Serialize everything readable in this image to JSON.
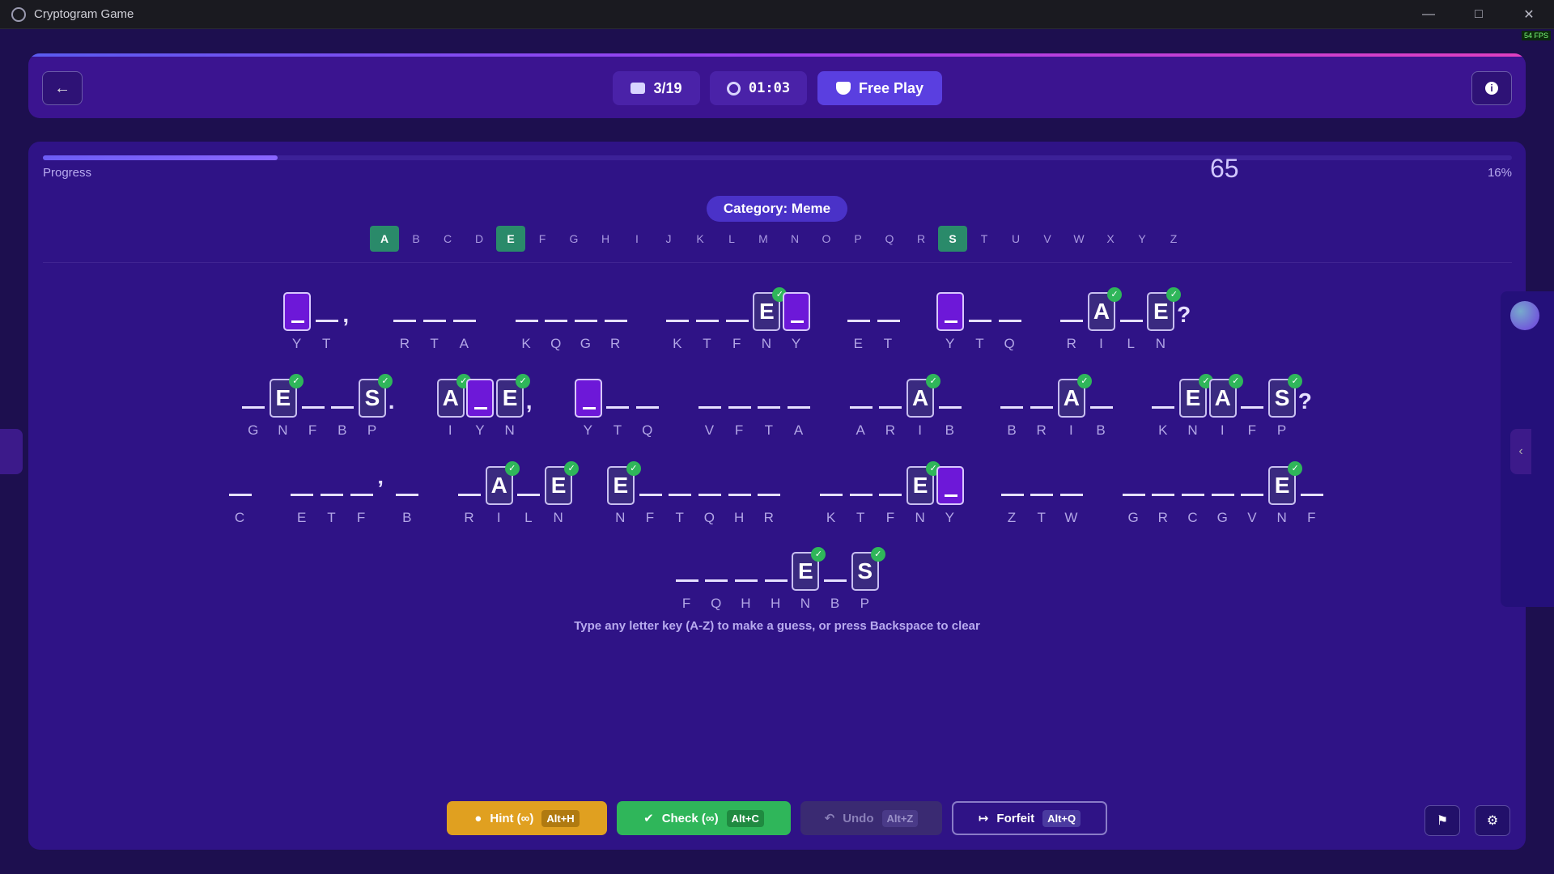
{
  "window": {
    "title": "Cryptogram Game",
    "fps": "54 FPS"
  },
  "header": {
    "puzzle": "3/19",
    "timer": "01:03",
    "mode": "Free Play"
  },
  "progress": {
    "label": "Progress",
    "percent_text": "16%",
    "fraction": 0.16
  },
  "category": "Category: Meme",
  "alphabet": [
    {
      "l": "A",
      "used": true
    },
    {
      "l": "B",
      "used": false
    },
    {
      "l": "C",
      "used": false
    },
    {
      "l": "D",
      "used": false
    },
    {
      "l": "E",
      "used": true
    },
    {
      "l": "F",
      "used": false
    },
    {
      "l": "G",
      "used": false
    },
    {
      "l": "H",
      "used": false
    },
    {
      "l": "I",
      "used": false
    },
    {
      "l": "J",
      "used": false
    },
    {
      "l": "K",
      "used": false
    },
    {
      "l": "L",
      "used": false
    },
    {
      "l": "M",
      "used": false
    },
    {
      "l": "N",
      "used": false
    },
    {
      "l": "O",
      "used": false
    },
    {
      "l": "P",
      "used": false
    },
    {
      "l": "Q",
      "used": false
    },
    {
      "l": "R",
      "used": false
    },
    {
      "l": "S",
      "used": true
    },
    {
      "l": "T",
      "used": false
    },
    {
      "l": "U",
      "used": false
    },
    {
      "l": "V",
      "used": false
    },
    {
      "l": "W",
      "used": false
    },
    {
      "l": "X",
      "used": false
    },
    {
      "l": "Y",
      "used": false
    },
    {
      "l": "Z",
      "used": false
    }
  ],
  "score": "65",
  "rows": [
    [
      {
        "c": "Y",
        "a": "",
        "s": "empty"
      },
      {
        "c": "T",
        "a": "",
        "s": "slot"
      },
      {
        "p": ","
      },
      {
        "gap": 1
      },
      {
        "c": "R",
        "a": "",
        "s": "slot"
      },
      {
        "c": "T",
        "a": "",
        "s": "slot"
      },
      {
        "c": "A",
        "a": "",
        "s": "slot"
      },
      {
        "gap": 1
      },
      {
        "c": "K",
        "a": "",
        "s": "slot"
      },
      {
        "c": "Q",
        "a": "",
        "s": "slot"
      },
      {
        "c": "G",
        "a": "",
        "s": "slot"
      },
      {
        "c": "R",
        "a": "",
        "s": "slot"
      },
      {
        "gap": 1
      },
      {
        "c": "K",
        "a": "",
        "s": "slot"
      },
      {
        "c": "T",
        "a": "",
        "s": "slot"
      },
      {
        "c": "F",
        "a": "",
        "s": "slot"
      },
      {
        "c": "N",
        "a": "E",
        "s": "filled"
      },
      {
        "c": "Y",
        "a": "",
        "s": "empty"
      },
      {
        "gap": 1
      },
      {
        "c": "E",
        "a": "",
        "s": "slot"
      },
      {
        "c": "T",
        "a": "",
        "s": "slot"
      },
      {
        "gap": 1
      },
      {
        "c": "Y",
        "a": "",
        "s": "empty"
      },
      {
        "c": "T",
        "a": "",
        "s": "slot"
      },
      {
        "c": "Q",
        "a": "",
        "s": "slot"
      },
      {
        "gap": 1
      },
      {
        "c": "R",
        "a": "",
        "s": "slot"
      },
      {
        "c": "I",
        "a": "A",
        "s": "filled"
      },
      {
        "c": "L",
        "a": "",
        "s": "slot"
      },
      {
        "c": "N",
        "a": "E",
        "s": "filled"
      },
      {
        "p": "?"
      }
    ],
    [
      {
        "c": "G",
        "a": "",
        "s": "slot"
      },
      {
        "c": "N",
        "a": "E",
        "s": "filled"
      },
      {
        "c": "F",
        "a": "",
        "s": "slot"
      },
      {
        "c": "B",
        "a": "",
        "s": "slot"
      },
      {
        "c": "P",
        "a": "S",
        "s": "filled"
      },
      {
        "p": "."
      },
      {
        "gap": 1
      },
      {
        "c": "I",
        "a": "A",
        "s": "filled"
      },
      {
        "c": "Y",
        "a": "",
        "s": "empty"
      },
      {
        "c": "N",
        "a": "E",
        "s": "filled"
      },
      {
        "p": ","
      },
      {
        "gap": 1
      },
      {
        "c": "Y",
        "a": "",
        "s": "empty"
      },
      {
        "c": "T",
        "a": "",
        "s": "slot"
      },
      {
        "c": "Q",
        "a": "",
        "s": "slot"
      },
      {
        "gap": 1
      },
      {
        "c": "V",
        "a": "",
        "s": "slot"
      },
      {
        "c": "F",
        "a": "",
        "s": "slot"
      },
      {
        "c": "T",
        "a": "",
        "s": "slot"
      },
      {
        "c": "A",
        "a": "",
        "s": "slot"
      },
      {
        "gap": 1
      },
      {
        "c": "A",
        "a": "",
        "s": "slot"
      },
      {
        "c": "R",
        "a": "",
        "s": "slot"
      },
      {
        "c": "I",
        "a": "A",
        "s": "filled"
      },
      {
        "c": "B",
        "a": "",
        "s": "slot"
      },
      {
        "gap": 1
      },
      {
        "c": "B",
        "a": "",
        "s": "slot"
      },
      {
        "c": "R",
        "a": "",
        "s": "slot"
      },
      {
        "c": "I",
        "a": "A",
        "s": "filled"
      },
      {
        "c": "B",
        "a": "",
        "s": "slot"
      },
      {
        "gap": 1
      },
      {
        "c": "K",
        "a": "",
        "s": "slot"
      },
      {
        "c": "N",
        "a": "E",
        "s": "filled"
      },
      {
        "c": "I",
        "a": "A",
        "s": "filled"
      },
      {
        "c": "F",
        "a": "",
        "s": "slot"
      },
      {
        "c": "P",
        "a": "S",
        "s": "filled"
      },
      {
        "p": "?"
      }
    ],
    [
      {
        "c": "C",
        "a": "",
        "s": "slot"
      },
      {
        "gap": 1
      },
      {
        "c": "E",
        "a": "",
        "s": "slot"
      },
      {
        "c": "T",
        "a": "",
        "s": "slot"
      },
      {
        "c": "F",
        "a": "",
        "s": "slot"
      },
      {
        "p": "’"
      },
      {
        "c": "B",
        "a": "",
        "s": "slot"
      },
      {
        "gap": 1
      },
      {
        "c": "R",
        "a": "",
        "s": "slot"
      },
      {
        "c": "I",
        "a": "A",
        "s": "filled"
      },
      {
        "c": "L",
        "a": "",
        "s": "slot"
      },
      {
        "c": "N",
        "a": "E",
        "s": "filled"
      },
      {
        "gap": 1
      },
      {
        "c": "N",
        "a": "E",
        "s": "filled"
      },
      {
        "c": "F",
        "a": "",
        "s": "slot"
      },
      {
        "c": "T",
        "a": "",
        "s": "slot"
      },
      {
        "c": "Q",
        "a": "",
        "s": "slot"
      },
      {
        "c": "H",
        "a": "",
        "s": "slot"
      },
      {
        "c": "R",
        "a": "",
        "s": "slot"
      },
      {
        "gap": 1
      },
      {
        "c": "K",
        "a": "",
        "s": "slot"
      },
      {
        "c": "T",
        "a": "",
        "s": "slot"
      },
      {
        "c": "F",
        "a": "",
        "s": "slot"
      },
      {
        "c": "N",
        "a": "E",
        "s": "filled"
      },
      {
        "c": "Y",
        "a": "",
        "s": "empty"
      },
      {
        "gap": 1
      },
      {
        "c": "Z",
        "a": "",
        "s": "slot"
      },
      {
        "c": "T",
        "a": "",
        "s": "slot"
      },
      {
        "c": "W",
        "a": "",
        "s": "slot"
      },
      {
        "gap": 1
      },
      {
        "c": "G",
        "a": "",
        "s": "slot"
      },
      {
        "c": "R",
        "a": "",
        "s": "slot"
      },
      {
        "c": "C",
        "a": "",
        "s": "slot"
      },
      {
        "c": "G",
        "a": "",
        "s": "slot"
      },
      {
        "c": "V",
        "a": "",
        "s": "slot"
      },
      {
        "c": "N",
        "a": "E",
        "s": "filled"
      },
      {
        "c": "F",
        "a": "",
        "s": "slot"
      }
    ],
    [
      {
        "c": "F",
        "a": "",
        "s": "slot"
      },
      {
        "c": "Q",
        "a": "",
        "s": "slot"
      },
      {
        "c": "H",
        "a": "",
        "s": "slot"
      },
      {
        "c": "H",
        "a": "",
        "s": "slot"
      },
      {
        "c": "N",
        "a": "E",
        "s": "filled"
      },
      {
        "c": "B",
        "a": "",
        "s": "slot"
      },
      {
        "c": "P",
        "a": "S",
        "s": "filled"
      }
    ]
  ],
  "instructions": "Type any letter key (A-Z) to make a guess, or press Backspace to clear",
  "actions": {
    "hint": {
      "label": "Hint (∞)",
      "key": "Alt+H"
    },
    "check": {
      "label": "Check (∞)",
      "key": "Alt+C"
    },
    "undo": {
      "label": "Undo",
      "key": "Alt+Z"
    },
    "forfeit": {
      "label": "Forfeit",
      "key": "Alt+Q"
    }
  },
  "colors": {
    "accent": "#5a3fe0",
    "success": "#2fb65a",
    "hint": "#e0a020",
    "background": "#1d0f4f"
  },
  "icons": {
    "back": "arrow-left-icon",
    "info": "info-icon",
    "flag": "flag-icon",
    "settings": "gear-icon"
  }
}
